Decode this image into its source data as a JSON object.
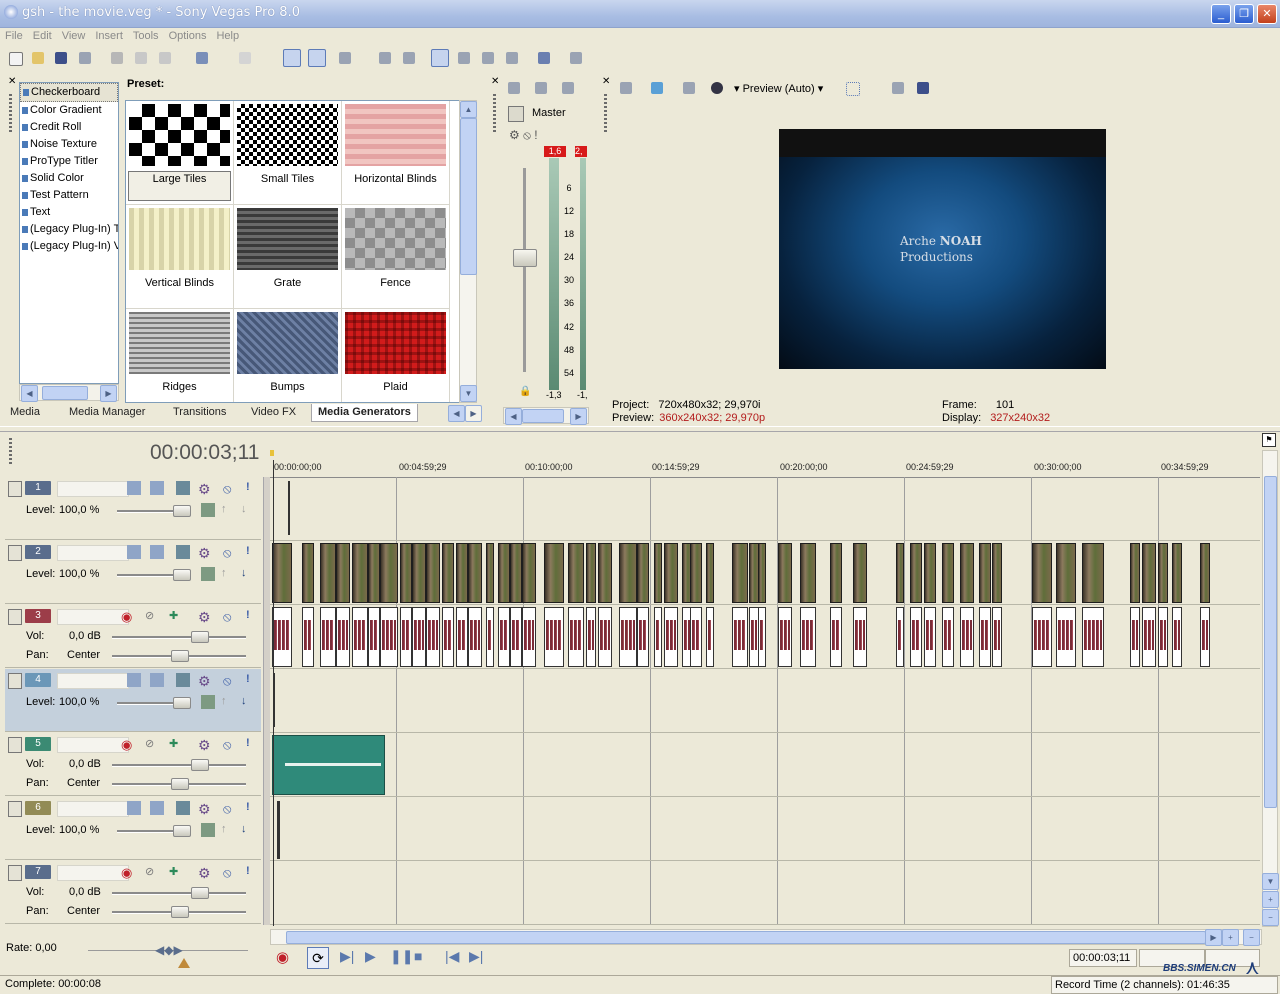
{
  "window": {
    "title": "gsh - the movie.veg * - Sony Vegas Pro 8.0",
    "minimize": "_",
    "maximize": "❐",
    "close": "✕"
  },
  "menu": [
    "File",
    "Edit",
    "View",
    "Insert",
    "Tools",
    "Options",
    "Help"
  ],
  "generators": {
    "list": [
      "Checkerboard",
      "Color Gradient",
      "Credit Roll",
      "Noise Texture",
      "ProType Titler",
      "Solid Color",
      "Test Pattern",
      "Text",
      "(Legacy Plug-In) T",
      "(Legacy Plug-In) V"
    ],
    "selected": "Checkerboard",
    "preset_label": "Preset:",
    "presets": [
      "Large Tiles",
      "Small Tiles",
      "Horizontal Blinds",
      "Vertical Blinds",
      "Grate",
      "Fence",
      "Ridges",
      "Bumps",
      "Plaid"
    ],
    "selected_preset": "Large Tiles"
  },
  "tabs": [
    "Media",
    "Media Manager",
    "Transitions",
    "Video FX",
    "Media Generators"
  ],
  "active_tab": "Media Generators",
  "mixer": {
    "master": "Master",
    "peak_left": "1.6",
    "peak_left_display": "1,6",
    "peak_right_display": "2,",
    "scale": [
      "6",
      "12",
      "18",
      "24",
      "30",
      "36",
      "42",
      "48",
      "54"
    ],
    "bottom_left": "-1,3",
    "bottom_right": "-1,"
  },
  "preview": {
    "mode": "Preview (Auto)",
    "caption_line1_a": "Arche",
    "caption_line1_b": "NOAH",
    "caption_line2": "Productions",
    "project_label": "Project:",
    "project_value": "720x480x32; 29,970i",
    "preview_label": "Preview:",
    "preview_value": "360x240x32; 29,970p",
    "frame_label": "Frame:",
    "frame_value": "101",
    "display_label": "Display:",
    "display_value": "327x240x32"
  },
  "timeline": {
    "timecode": "00:00:03;11",
    "ruler": [
      "00:00:00;00",
      "00:04:59;29",
      "00:10:00;00",
      "00:14:59;29",
      "00:20:00;00",
      "00:24:59;29",
      "00:30:00;00",
      "00:34:59;29"
    ],
    "tracks": [
      {
        "num": "1",
        "type": "video",
        "line1_label": "Level:",
        "line1_value": "100,0 %",
        "color": "#5a6d8c"
      },
      {
        "num": "2",
        "type": "video",
        "line1_label": "Level:",
        "line1_value": "100,0 %",
        "color": "#5a6d8c"
      },
      {
        "num": "3",
        "type": "audio",
        "vol_label": "Vol:",
        "vol_value": "0,0 dB",
        "pan_label": "Pan:",
        "pan_value": "Center",
        "color": "#9c3d49"
      },
      {
        "num": "4",
        "type": "video",
        "line1_label": "Level:",
        "line1_value": "100,0 %",
        "color": "#6b97b8"
      },
      {
        "num": "5",
        "type": "audio",
        "vol_label": "Vol:",
        "vol_value": "0,0 dB",
        "pan_label": "Pan:",
        "pan_value": "Center",
        "color": "#3b8a73"
      },
      {
        "num": "6",
        "type": "video",
        "line1_label": "Level:",
        "line1_value": "100,0 %",
        "color": "#928b56"
      },
      {
        "num": "7",
        "type": "audio",
        "vol_label": "Vol:",
        "vol_value": "0,0 dB",
        "pan_label": "Pan:",
        "pan_value": "Center",
        "color": "#5a6d8c"
      }
    ],
    "rate_label": "Rate: 0,00",
    "transport_time": "00:00:03;11"
  },
  "status": {
    "complete": "Complete: 00:00:08",
    "record_time": "Record Time (2 channels): 01:46:35",
    "watermark": "BBS.SIMEN.CN"
  },
  "colors": {
    "accent": "#3169c6",
    "audio_wave": "#7b2c37",
    "teal_clip": "#2f8a7a",
    "peak_red": "#d71a1a"
  }
}
